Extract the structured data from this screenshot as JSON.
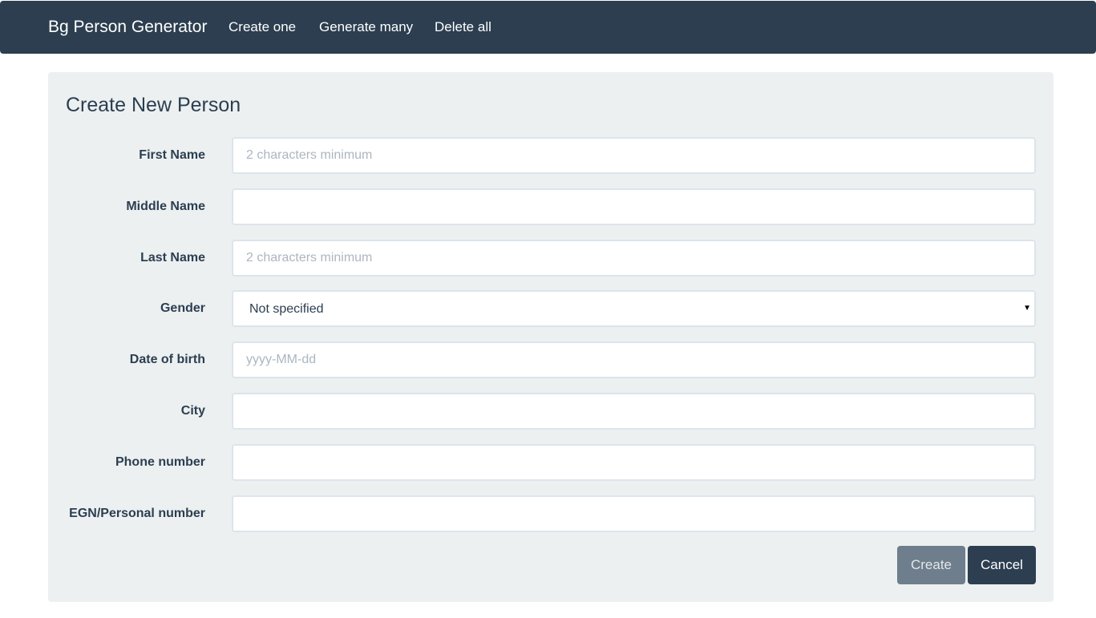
{
  "navbar": {
    "brand": "Bg Person Generator",
    "links": [
      "Create one",
      "Generate many",
      "Delete all"
    ]
  },
  "form": {
    "title": "Create New Person",
    "fields": {
      "first_name": {
        "label": "First Name",
        "value": "",
        "placeholder": "2 characters minimum"
      },
      "middle_name": {
        "label": "Middle Name",
        "value": "",
        "placeholder": ""
      },
      "last_name": {
        "label": "Last Name",
        "value": "",
        "placeholder": "2 characters minimum"
      },
      "gender": {
        "label": "Gender",
        "value": "Not specified"
      },
      "date_of_birth": {
        "label": "Date of birth",
        "value": "",
        "placeholder": "yyyy-MM-dd"
      },
      "city": {
        "label": "City",
        "value": "",
        "placeholder": ""
      },
      "phone": {
        "label": "Phone number",
        "value": "",
        "placeholder": ""
      },
      "egn": {
        "label": "EGN/Personal number",
        "value": "",
        "placeholder": ""
      }
    },
    "buttons": {
      "create": "Create",
      "cancel": "Cancel"
    }
  },
  "icons": {
    "select_caret": "caret-down-icon"
  },
  "colors": {
    "navbar_bg": "#2c3e50",
    "well_bg": "#ecf0f1",
    "create_button": "#6f7e8c",
    "cancel_button": "#2c3e50"
  }
}
